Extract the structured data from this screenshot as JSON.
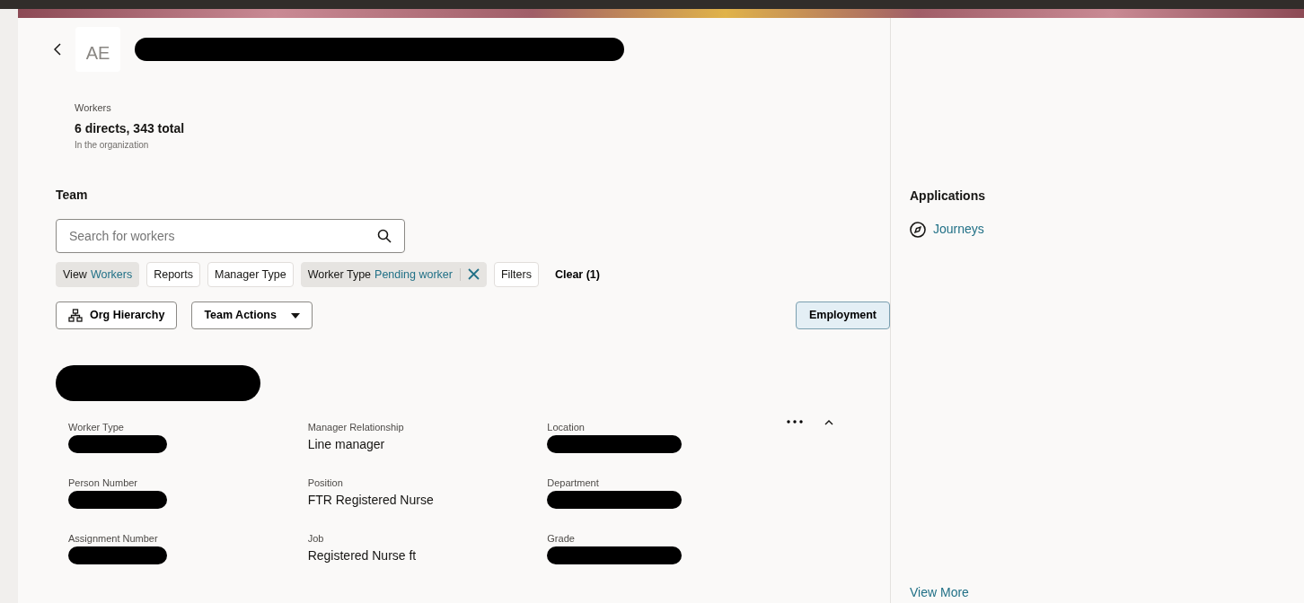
{
  "header": {
    "avatar": "AE",
    "title_redacted": true
  },
  "summary": {
    "label": "Workers",
    "value": "6 directs, 343 total",
    "note": "In the organization"
  },
  "team": {
    "heading": "Team",
    "search": {
      "placeholder": "Search for workers"
    },
    "filters": [
      {
        "label": "View",
        "value": "Workers",
        "selected": true,
        "removable": false
      },
      {
        "label": "Reports",
        "selected": false,
        "removable": false
      },
      {
        "label": "Manager Type",
        "selected": false,
        "removable": false
      },
      {
        "label": "Worker Type",
        "value": "Pending worker",
        "selected": true,
        "removable": true
      },
      {
        "label": "Filters",
        "selected": false,
        "removable": false
      }
    ],
    "clear": "Clear (1)",
    "actions": [
      {
        "kind": "hierarchy",
        "label": "Org Hierarchy"
      },
      {
        "kind": "dropdown",
        "label": "Team Actions"
      }
    ],
    "view_toggle": {
      "label": "Employment",
      "selected": true
    },
    "worker": {
      "name_redacted": true,
      "expanded": true,
      "fields": [
        {
          "label": "Worker Type",
          "redacted": true
        },
        {
          "label": "Manager Relationship",
          "value": "Line manager",
          "redacted": false
        },
        {
          "label": "Location",
          "redacted": true
        },
        {
          "label": "Person Number",
          "redacted": true
        },
        {
          "label": "Position",
          "value": "FTR Registered Nurse",
          "redacted": false
        },
        {
          "label": "Department",
          "redacted": true
        },
        {
          "label": "Assignment Number",
          "redacted": true
        },
        {
          "label": "Job",
          "value": "Registered Nurse ft",
          "redacted": false
        },
        {
          "label": "Grade",
          "redacted": true
        }
      ]
    }
  },
  "applications": {
    "heading": "Applications",
    "items": [
      {
        "label": "Journeys"
      }
    ],
    "more": "View More"
  }
}
